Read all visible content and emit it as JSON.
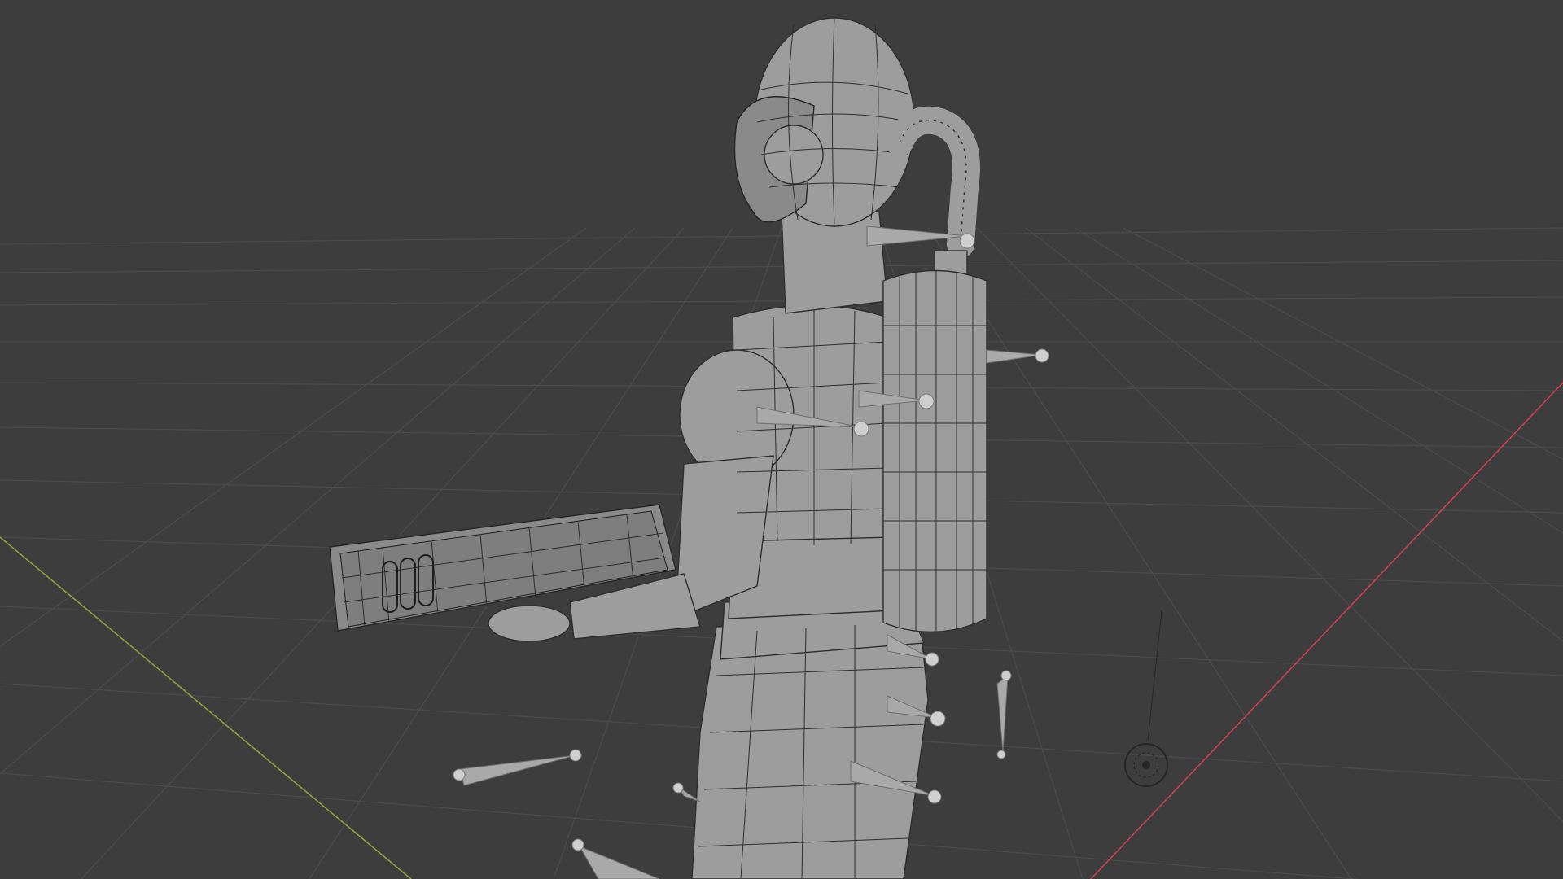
{
  "app": "3D viewport",
  "viewport": {
    "background_color": "#3d3d3d",
    "grid_color": "#4a4a4a",
    "x_axis_color": "#c8414f",
    "y_axis_color": "#8fa13a"
  },
  "scene_objects": [
    {
      "name": "character-mesh"
    },
    {
      "name": "oxygen-tank"
    },
    {
      "name": "breathing-hose"
    },
    {
      "name": "held-device"
    },
    {
      "name": "armature-bones"
    },
    {
      "name": "light-empty"
    }
  ],
  "icons": {
    "light": "light-icon"
  }
}
